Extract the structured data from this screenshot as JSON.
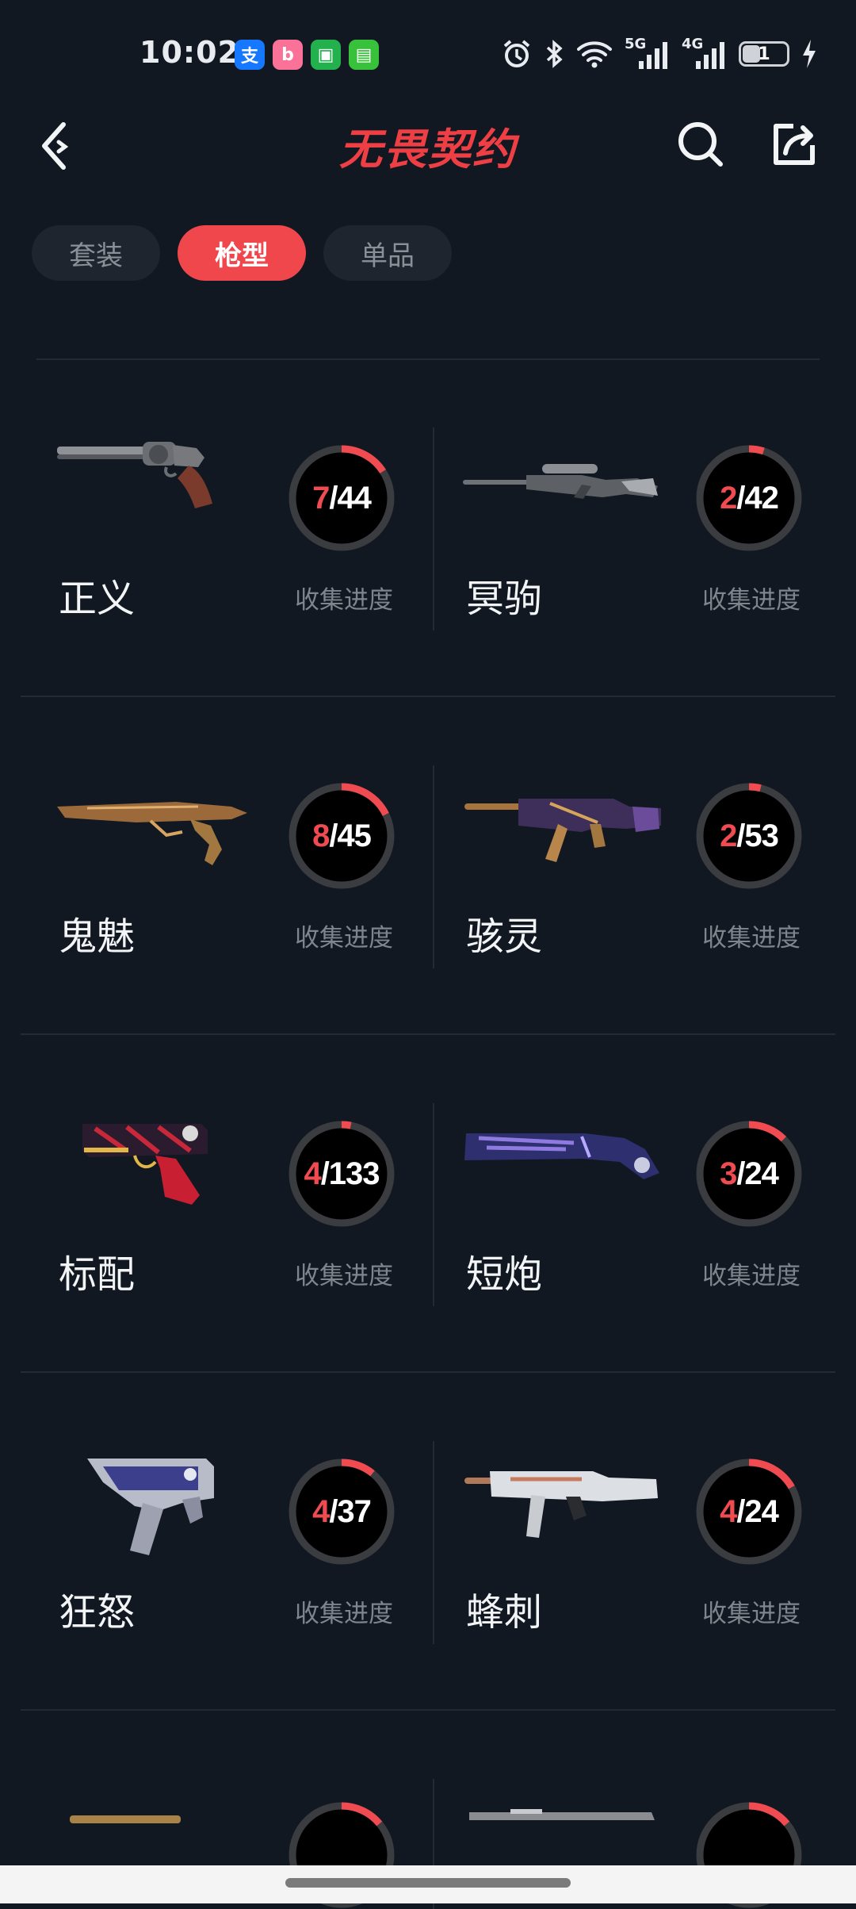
{
  "status_bar": {
    "time": "10:02",
    "app_icons": [
      {
        "name": "alipay-icon",
        "glyph": "支",
        "color": "#1677ff"
      },
      {
        "name": "bilibili-icon",
        "glyph": "b",
        "color": "#fb7299"
      },
      {
        "name": "store-icon",
        "glyph": "▣",
        "color": "#22b14c"
      },
      {
        "name": "message-icon",
        "glyph": "▤",
        "color": "#38c13a"
      }
    ],
    "net_5g": "5G",
    "net_4g": "4G",
    "battery": "1"
  },
  "header": {
    "title": "无畏契约",
    "title_color": "#ee3f45"
  },
  "tabs": [
    {
      "label": "套装",
      "active": false
    },
    {
      "label": "枪型",
      "active": true
    },
    {
      "label": "单品",
      "active": false
    }
  ],
  "progress_label": "收集进度",
  "weapons": [
    {
      "name": "正义",
      "owned": "7",
      "total": "/44",
      "fraction": 0.159,
      "icon": "revolver-image"
    },
    {
      "name": "冥驹",
      "owned": "2",
      "total": "/42",
      "fraction": 0.048,
      "icon": "sniper-rifle-image"
    },
    {
      "name": "鬼魅",
      "owned": "8",
      "total": "/45",
      "fraction": 0.178,
      "icon": "pistol-image"
    },
    {
      "name": "骇灵",
      "owned": "2",
      "total": "/53",
      "fraction": 0.038,
      "icon": "smg-image"
    },
    {
      "name": "标配",
      "owned": "4",
      "total": "/133",
      "fraction": 0.03,
      "icon": "classic-pistol-image"
    },
    {
      "name": "短炮",
      "owned": "3",
      "total": "/24",
      "fraction": 0.125,
      "icon": "short-shotgun-image"
    },
    {
      "name": "狂怒",
      "owned": "4",
      "total": "/37",
      "fraction": 0.108,
      "icon": "frenzy-pistol-image"
    },
    {
      "name": "蜂刺",
      "owned": "4",
      "total": "/24",
      "fraction": 0.167,
      "icon": "stinger-smg-image"
    },
    {
      "name": "",
      "owned": "",
      "total": "",
      "fraction": 0.14,
      "icon": "rifle-image"
    },
    {
      "name": "",
      "owned": "",
      "total": "",
      "fraction": 0.14,
      "icon": "rifle-image"
    }
  ]
}
